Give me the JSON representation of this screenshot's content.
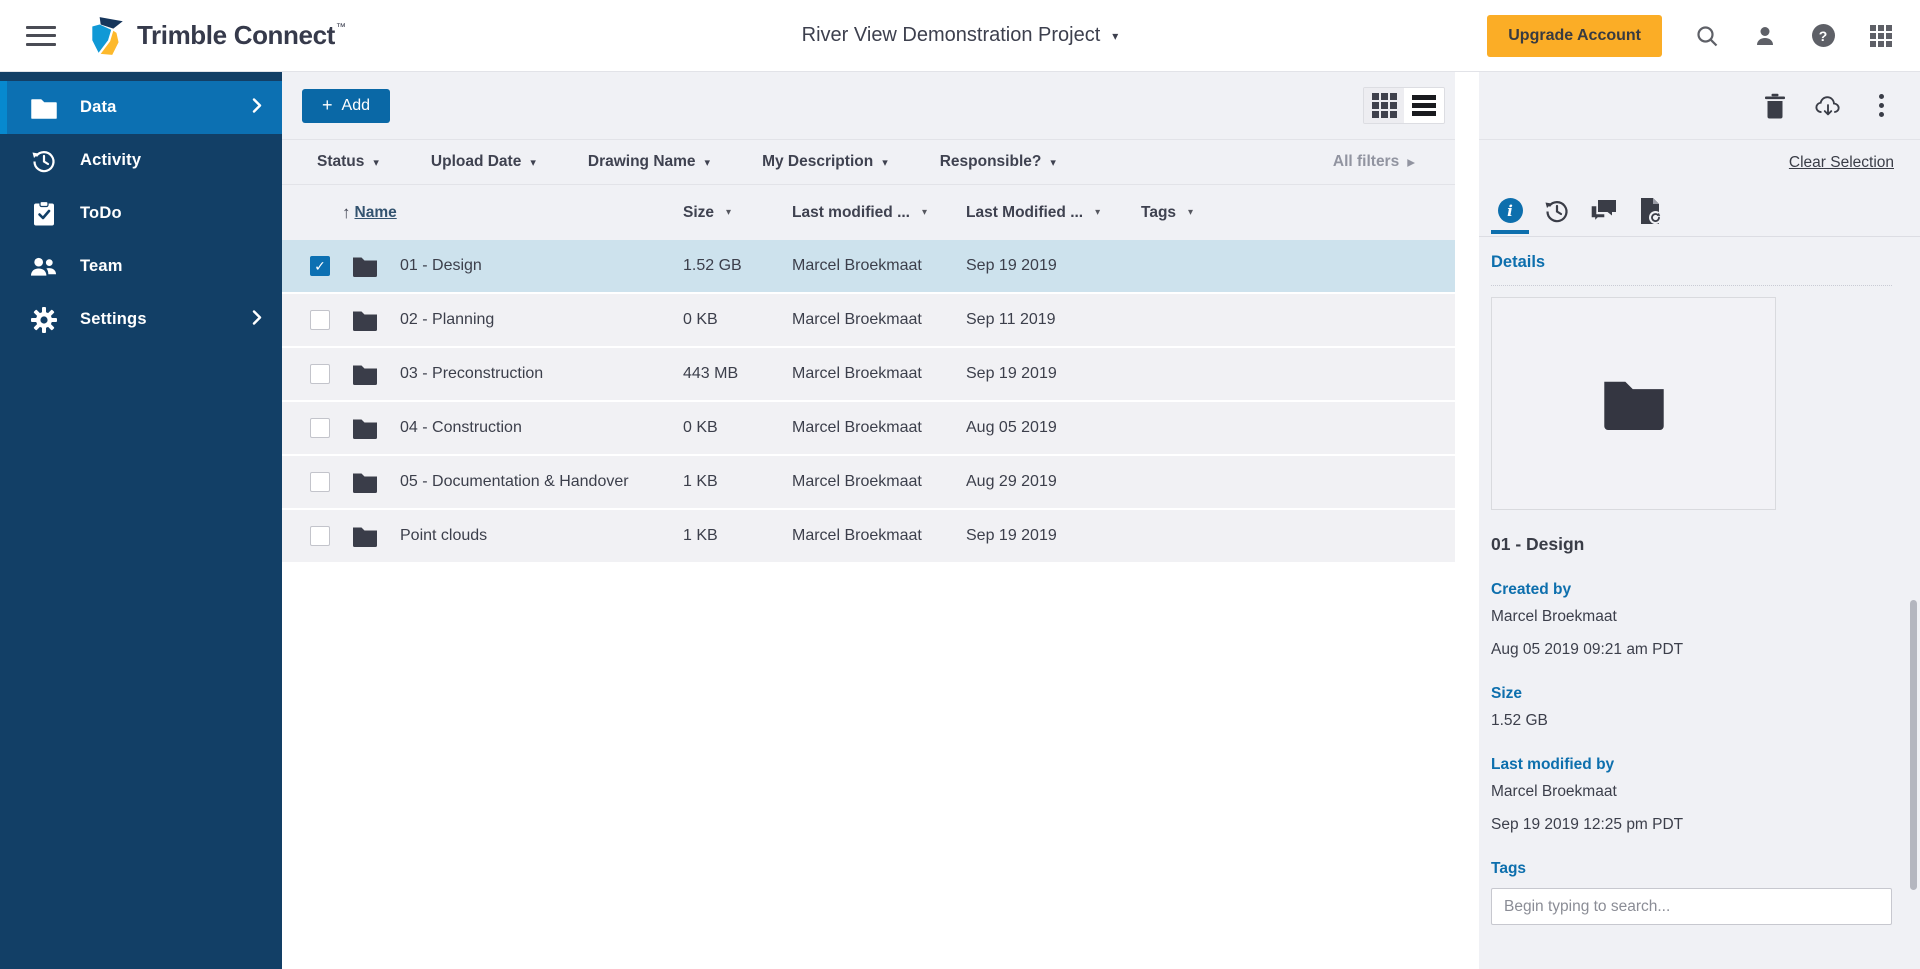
{
  "header": {
    "logo_text_1": "Trimble",
    "logo_text_2": "Connect",
    "project_title": "River View Demonstration Project",
    "upgrade_label": "Upgrade Account"
  },
  "sidebar": {
    "items": [
      {
        "label": "Data",
        "selected": true
      },
      {
        "label": "Activity",
        "selected": false
      },
      {
        "label": "ToDo",
        "selected": false
      },
      {
        "label": "Team",
        "selected": false
      },
      {
        "label": "Settings",
        "selected": false
      }
    ]
  },
  "toolbar": {
    "add_label": "Add"
  },
  "filters": {
    "items": [
      "Status",
      "Upload Date",
      "Drawing Name",
      "My Description",
      "Responsible?"
    ],
    "all_filters_label": "All filters"
  },
  "table": {
    "columns": {
      "name": "Name",
      "size": "Size",
      "modified_by": "Last modified ...",
      "modified_on": "Last Modified ...",
      "tags": "Tags"
    },
    "rows": [
      {
        "name": "01 - Design",
        "size": "1.52 GB",
        "modified_by": "Marcel Broekmaat",
        "modified_on": "Sep 19 2019",
        "selected": true
      },
      {
        "name": "02 - Planning",
        "size": "0 KB",
        "modified_by": "Marcel Broekmaat",
        "modified_on": "Sep 11 2019",
        "selected": false
      },
      {
        "name": "03 - Preconstruction",
        "size": "443 MB",
        "modified_by": "Marcel Broekmaat",
        "modified_on": "Sep 19 2019",
        "selected": false
      },
      {
        "name": "04 - Construction",
        "size": "0 KB",
        "modified_by": "Marcel Broekmaat",
        "modified_on": "Aug 05 2019",
        "selected": false
      },
      {
        "name": "05 - Documentation & Handover",
        "size": "1 KB",
        "modified_by": "Marcel Broekmaat",
        "modified_on": "Aug 29 2019",
        "selected": false
      },
      {
        "name": "Point clouds",
        "size": "1 KB",
        "modified_by": "Marcel Broekmaat",
        "modified_on": "Sep 19 2019",
        "selected": false
      }
    ]
  },
  "details_panel": {
    "clear_selection_label": "Clear Selection",
    "heading": "Details",
    "item_title": "01 - Design",
    "created_by_label": "Created by",
    "created_by": "Marcel Broekmaat",
    "created_on": "Aug 05 2019 09:21 am PDT",
    "size_label": "Size",
    "size": "1.52 GB",
    "modified_by_label": "Last modified by",
    "modified_by": "Marcel Broekmaat",
    "modified_on": "Sep 19 2019 12:25 pm PDT",
    "tags_label": "Tags",
    "tags_placeholder": "Begin typing to search..."
  },
  "icons": {
    "caret_down": "▾",
    "sort_asc": "↑",
    "arrow_right": "▸",
    "plus": "+",
    "check": "✓",
    "question_mark": "?",
    "info_i": "i",
    "trademark": "™"
  },
  "colors": {
    "sidebar_navy": "#123f66",
    "selected_blue": "#0c70b2",
    "accent_stripe": "#0789cf",
    "primary_blue": "#0d6fad",
    "upgrade_amber": "#fbad26",
    "selected_row": "#cde2ed",
    "row_gray": "#f1f1f4",
    "bar_gray": "#f0f1f5",
    "text_dark": "#3c3f4b"
  }
}
